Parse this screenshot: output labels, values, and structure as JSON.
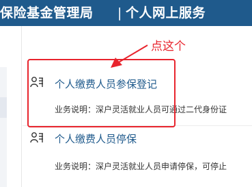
{
  "header": {
    "title": "保险基金管理局",
    "separator": "|",
    "subtitle": "个人网上服务"
  },
  "annotation": {
    "text": "点这个"
  },
  "services": [
    {
      "name": "个人缴费人员参保登记",
      "description": "业务说明：深户灵活就业人员可通过二代身份证"
    },
    {
      "name": "个人缴费人员停保",
      "description": "业务说明：深户灵活就业人员申请停保，可停止"
    }
  ],
  "colors": {
    "header_bg": "#1f5a8c",
    "link": "#1f5a8c",
    "annotation": "#e8242d"
  }
}
